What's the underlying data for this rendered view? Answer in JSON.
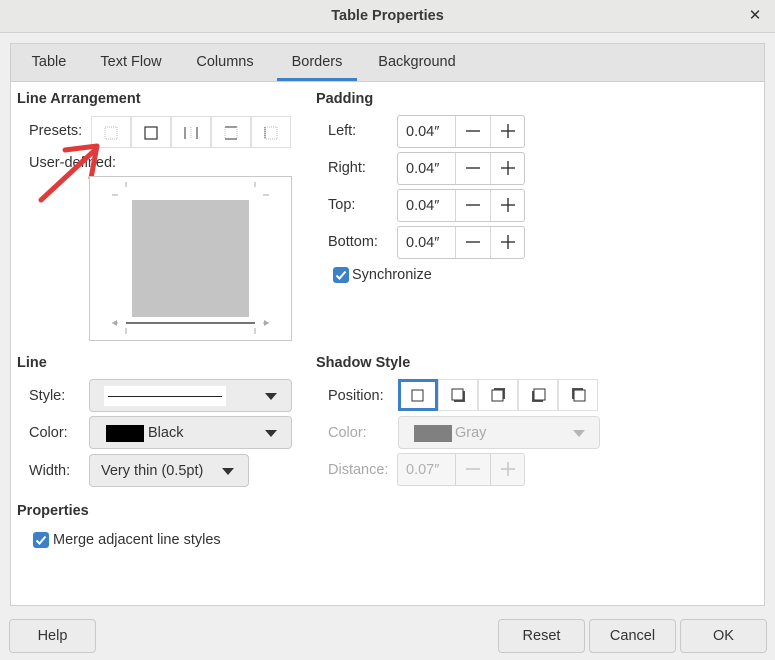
{
  "window": {
    "title": "Table Properties"
  },
  "tabs": [
    {
      "label": "Table"
    },
    {
      "label": "Text Flow"
    },
    {
      "label": "Columns"
    },
    {
      "label": "Borders",
      "active": true
    },
    {
      "label": "Background"
    }
  ],
  "line_arrangement": {
    "heading": "Line Arrangement",
    "presets_label": "Presets:",
    "user_defined_label": "User-defined:",
    "presets": [
      "no-borders-icon",
      "outer-border-icon",
      "outer-vertical-borders-icon",
      "outer-horizontal-borders-icon",
      "left-border-icon"
    ]
  },
  "padding": {
    "heading": "Padding",
    "left_label": "Left:",
    "left_value": "0.04″",
    "right_label": "Right:",
    "right_value": "0.04″",
    "top_label": "Top:",
    "top_value": "0.04″",
    "bottom_label": "Bottom:",
    "bottom_value": "0.04″",
    "synchronize_label": "Synchronize",
    "synchronize_checked": true
  },
  "line": {
    "heading": "Line",
    "style_label": "Style:",
    "color_label": "Color:",
    "color_value": "Black",
    "color_swatch": "#000000",
    "width_label": "Width:",
    "width_value": "Very thin (0.5pt)"
  },
  "shadow_style": {
    "heading": "Shadow Style",
    "position_label": "Position:",
    "positions": [
      "no-shadow-icon",
      "shadow-bottom-right-icon",
      "shadow-top-right-icon",
      "shadow-bottom-left-icon",
      "shadow-top-left-icon"
    ],
    "color_label": "Color:",
    "color_value": "Gray",
    "color_swatch": "#808080",
    "distance_label": "Distance:",
    "distance_value": "0.07″"
  },
  "properties": {
    "heading": "Properties",
    "merge_label": "Merge adjacent line styles",
    "merge_checked": true
  },
  "footer": {
    "help": "Help",
    "reset": "Reset",
    "cancel": "Cancel",
    "ok": "OK"
  },
  "colors": {
    "accent": "#3b80c8",
    "annotation_arrow": "#e03a3a"
  }
}
